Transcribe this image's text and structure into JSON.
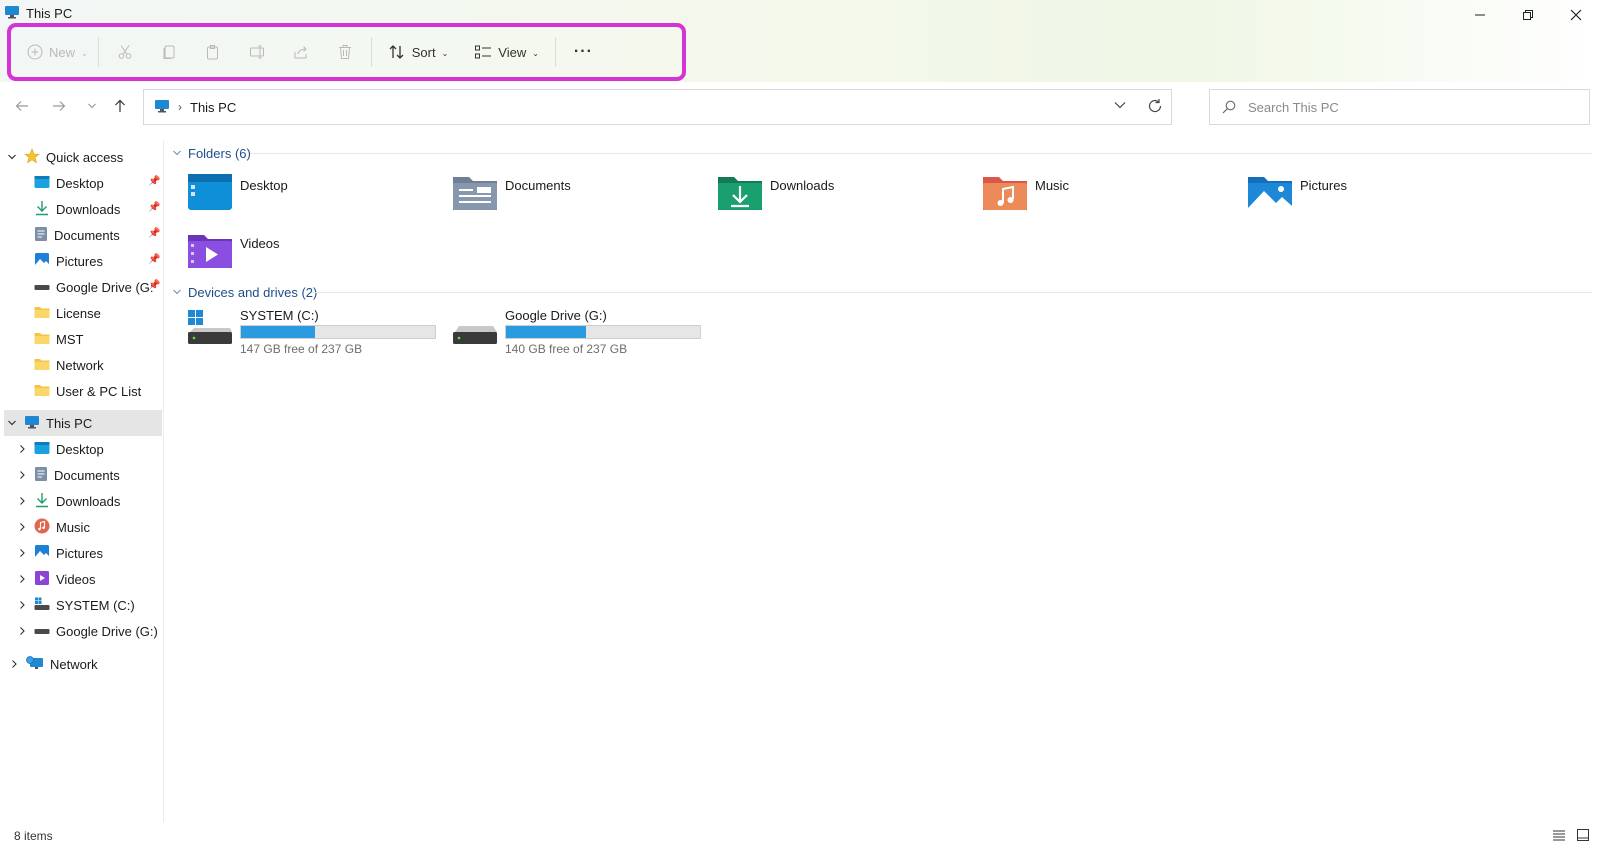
{
  "window": {
    "title": "This PC"
  },
  "toolbar": {
    "new_label": "New",
    "sort_label": "Sort",
    "view_label": "View",
    "more_label": "···"
  },
  "address": {
    "location": "This PC"
  },
  "search": {
    "placeholder": "Search This PC"
  },
  "sidebar": {
    "quick_access": {
      "label": "Quick access",
      "items": [
        {
          "label": "Desktop",
          "icon": "desktop-icon",
          "pinned": true
        },
        {
          "label": "Downloads",
          "icon": "downloads-icon",
          "pinned": true
        },
        {
          "label": "Documents",
          "icon": "documents-icon",
          "pinned": true
        },
        {
          "label": "Pictures",
          "icon": "pictures-icon",
          "pinned": true
        },
        {
          "label": "Google Drive (G:",
          "icon": "drive-icon",
          "pinned": true
        },
        {
          "label": "License",
          "icon": "folder-icon",
          "pinned": false
        },
        {
          "label": "MST",
          "icon": "folder-icon",
          "pinned": false
        },
        {
          "label": "Network",
          "icon": "folder-icon",
          "pinned": false
        },
        {
          "label": "User & PC List",
          "icon": "folder-icon",
          "pinned": false
        }
      ]
    },
    "this_pc": {
      "label": "This PC",
      "items": [
        {
          "label": "Desktop",
          "icon": "desktop-icon"
        },
        {
          "label": "Documents",
          "icon": "documents-icon"
        },
        {
          "label": "Downloads",
          "icon": "downloads-icon"
        },
        {
          "label": "Music",
          "icon": "music-icon"
        },
        {
          "label": "Pictures",
          "icon": "pictures-icon"
        },
        {
          "label": "Videos",
          "icon": "videos-icon"
        },
        {
          "label": "SYSTEM (C:)",
          "icon": "system-drive-icon"
        },
        {
          "label": "Google Drive (G:)",
          "icon": "drive-icon"
        }
      ]
    },
    "network": {
      "label": "Network"
    }
  },
  "content": {
    "folders_header": "Folders (6)",
    "folders": [
      {
        "label": "Desktop",
        "icon": "desktop-folder-icon"
      },
      {
        "label": "Documents",
        "icon": "documents-folder-icon"
      },
      {
        "label": "Downloads",
        "icon": "downloads-folder-icon"
      },
      {
        "label": "Music",
        "icon": "music-folder-icon"
      },
      {
        "label": "Pictures",
        "icon": "pictures-folder-icon"
      },
      {
        "label": "Videos",
        "icon": "videos-folder-icon"
      }
    ],
    "drives_header": "Devices and drives (2)",
    "drives": [
      {
        "label": "SYSTEM (C:)",
        "free_text": "147 GB free of 237 GB",
        "used_fraction": 0.38,
        "icon": "system-drive-icon"
      },
      {
        "label": "Google Drive (G:)",
        "free_text": "140 GB free of 237 GB",
        "used_fraction": 0.41,
        "icon": "drive-icon"
      }
    ]
  },
  "status": {
    "item_count": "8 items"
  },
  "colors": {
    "toolbar_highlight": "#d633d6",
    "drive_fill": "#2a9be0",
    "group_header": "#1f4e8c",
    "selected_row": "#e5e5e5"
  }
}
